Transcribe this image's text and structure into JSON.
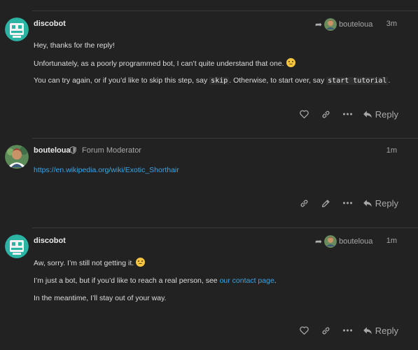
{
  "posts": [
    {
      "username": "discobot",
      "reply_to_user": "bouteloua",
      "time": "3m",
      "paragraphs": {
        "p1": "Hey, thanks for the reply!",
        "p2_text": "Unfortunately, as a poorly programmed bot, I can’t quite understand that one.",
        "p3_a": "You can try again, or if you’d like to skip this step, say ",
        "p3_code1": "skip",
        "p3_b": ". Otherwise, to start over, say ",
        "p3_code2": "start tutorial",
        "p3_c": "."
      },
      "reply_label": "Reply"
    },
    {
      "username": "bouteloua",
      "user_title": "Forum Moderator",
      "time": "1m",
      "link": "https://en.wikipedia.org/wiki/Exotic_Shorthair",
      "reply_label": "Reply"
    },
    {
      "username": "discobot",
      "reply_to_user": "bouteloua",
      "time": "1m",
      "paragraphs": {
        "p1": "Aw, sorry. I’m still not getting it.",
        "p2_a": "I’m just a bot, but if you’d like to reach a real person, see ",
        "p2_link": "our contact page",
        "p2_b": ".",
        "p3": "In the meantime, I’ll stay out of your way."
      },
      "reply_label": "Reply"
    }
  ],
  "colors": {
    "background": "#222222",
    "link": "#3ca4e3",
    "discobot_avatar": "#2bb3a3"
  }
}
